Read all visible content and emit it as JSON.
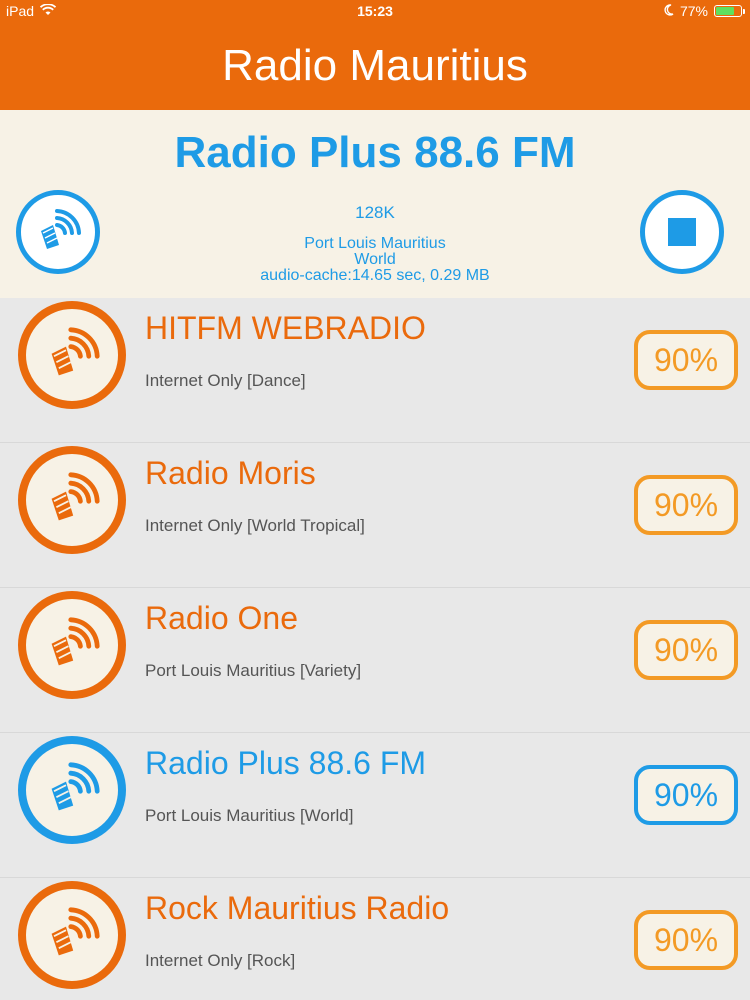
{
  "status_bar": {
    "device": "iPad",
    "time": "15:23",
    "battery": "77%",
    "battery_level": 0.77
  },
  "header": {
    "title": "Radio Mauritius"
  },
  "now_playing": {
    "title": "Radio Plus 88.6 FM",
    "bitrate": "128K",
    "location": "Port Louis Mauritius",
    "genre": "World",
    "cache": "audio-cache:14.65 sec, 0.29 MB"
  },
  "stations": [
    {
      "name": "HITFM WEBRADIO",
      "desc": "Internet Only [Dance]",
      "pct": "90%",
      "active": false
    },
    {
      "name": "Radio Moris",
      "desc": "Internet Only [World Tropical]",
      "pct": "90%",
      "active": false
    },
    {
      "name": "Radio One",
      "desc": "Port Louis Mauritius [Variety]",
      "pct": "90%",
      "active": false
    },
    {
      "name": "Radio Plus 88.6 FM",
      "desc": "Port Louis Mauritius [World]",
      "pct": "90%",
      "active": true
    },
    {
      "name": "Rock Mauritius Radio",
      "desc": "Internet Only [Rock]",
      "pct": "90%",
      "active": false
    }
  ],
  "colors": {
    "brand_orange": "#ea6a0c",
    "accent_blue": "#1e9be6",
    "badge_orange": "#f39a25"
  },
  "icons": {
    "station": "speaker-waves-icon",
    "stop": "stop-icon",
    "wifi": "wifi-icon",
    "moon": "moon-icon",
    "battery": "battery-icon"
  }
}
